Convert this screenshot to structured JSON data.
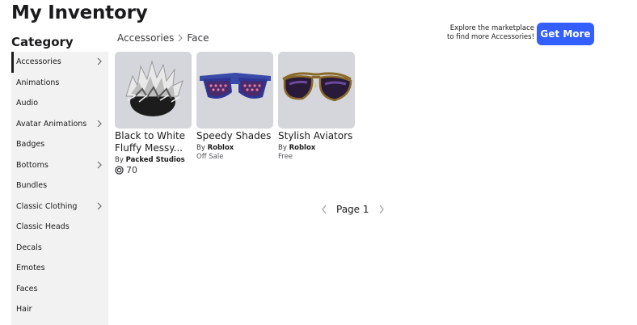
{
  "page": {
    "title": "My Inventory"
  },
  "sidebar": {
    "heading": "Category",
    "items": [
      {
        "label": "Accessories",
        "active": true,
        "chevron": true
      },
      {
        "label": "Animations",
        "chevron": false
      },
      {
        "label": "Audio",
        "chevron": false
      },
      {
        "label": "Avatar Animations",
        "chevron": true
      },
      {
        "label": "Badges",
        "chevron": false
      },
      {
        "label": "Bottoms",
        "chevron": true
      },
      {
        "label": "Bundles",
        "chevron": false
      },
      {
        "label": "Classic Clothing",
        "chevron": true
      },
      {
        "label": "Classic Heads",
        "chevron": false
      },
      {
        "label": "Decals",
        "chevron": false
      },
      {
        "label": "Emotes",
        "chevron": false
      },
      {
        "label": "Faces",
        "chevron": false
      },
      {
        "label": "Hair",
        "chevron": false
      }
    ]
  },
  "breadcrumb": {
    "root": "Accessories",
    "current": "Face"
  },
  "promo": {
    "line1": "Explore the marketplace",
    "line2": "to find more Accessories!",
    "button": "Get More"
  },
  "items": [
    {
      "name_line1": "Black to White",
      "name_line2": "Fluffy Messy...",
      "by": "By",
      "creator": "Packed Studios",
      "price": "70",
      "icon": "messy-hair-thumbnail"
    },
    {
      "name_line1": "Speedy Shades",
      "name_line2": "",
      "by": "By",
      "creator": "Roblox",
      "status": "Off Sale",
      "icon": "speedy-shades-thumbnail"
    },
    {
      "name_line1": "Stylish Aviators",
      "name_line2": "",
      "by": "By",
      "creator": "Roblox",
      "status": "Free",
      "icon": "aviator-glasses-thumbnail"
    }
  ],
  "pagination": {
    "label": "Page 1"
  },
  "colors": {
    "accent": "#335fff",
    "sidebar_bg": "#f2f2f2",
    "thumb_bg": "#d5d6db"
  }
}
